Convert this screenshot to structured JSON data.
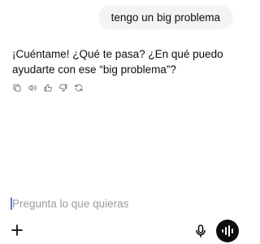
{
  "conversation": {
    "user_message": "tengo un big problema",
    "assistant_message": "¡Cuéntame! ¿Qué te pasa? ¿En qué puedo ayudarte con ese “big problema”?"
  },
  "message_actions": [
    {
      "icon": "copy-icon"
    },
    {
      "icon": "speaker-icon"
    },
    {
      "icon": "thumbs-up-icon"
    },
    {
      "icon": "thumbs-down-icon"
    },
    {
      "icon": "regenerate-icon"
    }
  ],
  "composer": {
    "placeholder": "Pregunta lo que quieras",
    "value": "",
    "buttons": {
      "attach": "plus-icon",
      "dictate": "microphone-icon",
      "voice_mode": "voice-mode-icon"
    }
  },
  "colors": {
    "user_bubble": "#f4f4f4",
    "text": "#0d0d0d",
    "icon": "#5d5d5d",
    "placeholder": "#9b9b9b",
    "caret": "#4a7bf0",
    "voice_button": "#0d0d0d"
  }
}
